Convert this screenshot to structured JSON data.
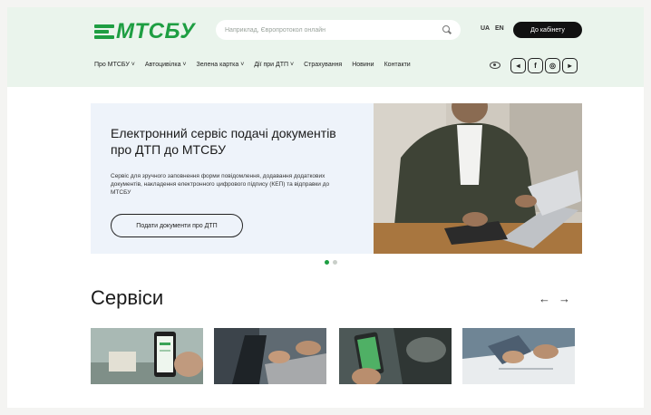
{
  "brand": {
    "logo_text": "МТСБУ",
    "color": "#1e9e42"
  },
  "header": {
    "search": {
      "placeholder": "Наприклад, Європротокол онлайн"
    },
    "lang": {
      "ua": "UA",
      "en": "EN"
    },
    "cabinet_button": "До кабінету"
  },
  "nav": {
    "items": [
      {
        "label": "Про МТСБУ ˅"
      },
      {
        "label": "Автоцивілка ˅"
      },
      {
        "label": "Зелена картка ˅"
      },
      {
        "label": "Дії при ДТП ˅"
      },
      {
        "label": "Страхування"
      },
      {
        "label": "Новини"
      },
      {
        "label": "Контакти"
      }
    ],
    "social": [
      {
        "icon": "telegram-icon",
        "glyph": "◂"
      },
      {
        "icon": "facebook-icon",
        "glyph": "f"
      },
      {
        "icon": "instagram-icon",
        "glyph": "◎"
      },
      {
        "icon": "youtube-icon",
        "glyph": "▸"
      }
    ]
  },
  "hero": {
    "title": "Електронний сервіс подачі документів про ДТП до МТСБУ",
    "description": "Сервіс для зручного заповнення форми повідомлення, додавання додаткових документів, накладення електронного цифрового підпису (КЕП) та відправки до МТСБУ",
    "button": "Подати документи про ДТП",
    "slides": {
      "total": 2,
      "active": 1
    }
  },
  "services": {
    "title": "Сервіси",
    "prev_arrow": "←",
    "next_arrow": "→"
  },
  "colors": {
    "accent": "#1e9e42",
    "header_bg": "#eaf4ec",
    "hero_bg": "#eef3fa"
  }
}
